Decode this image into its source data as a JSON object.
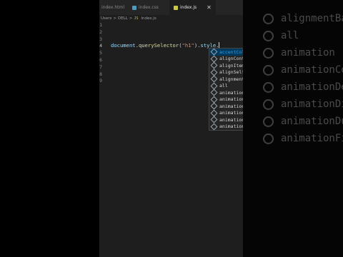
{
  "tabs": [
    {
      "label": "index.html",
      "icon": "html-file-icon",
      "color": "#e37933"
    },
    {
      "label": "index.css",
      "icon": "css-file-icon",
      "color": "#519aba"
    },
    {
      "label": "index.js",
      "icon": "js-file-icon",
      "color": "#cbcb41",
      "active": true
    }
  ],
  "close_label": "✕",
  "breadcrumb": {
    "parts": [
      "Users",
      "DELL"
    ],
    "separator": ">",
    "badge": "JS",
    "file": "index.js"
  },
  "gutter": {
    "lines": [
      "1",
      "2",
      "3",
      "4",
      "5",
      "6",
      "7",
      "8",
      "9"
    ],
    "current_line": "4"
  },
  "code": {
    "object": "document",
    "dot1": ".",
    "method": "querySelector",
    "open": "(",
    "arg": "\"h1\"",
    "close": ")",
    "dot2": ".",
    "prop": "style",
    "dot3": "."
  },
  "suggestions": [
    {
      "label": "accentColor",
      "selected": true
    },
    {
      "label": "alignContent"
    },
    {
      "label": "alignItems"
    },
    {
      "label": "alignSelf"
    },
    {
      "label": "alignmentBaseline"
    },
    {
      "label": "all"
    },
    {
      "label": "animation"
    },
    {
      "label": "animationComposition"
    },
    {
      "label": "animationDelay"
    },
    {
      "label": "animationDirection"
    },
    {
      "label": "animationDuration"
    },
    {
      "label": "animationFillMode"
    },
    {
      "label": "animationIterationCount"
    }
  ],
  "backdrop": [
    "alignmentBaseline",
    "all",
    "animation",
    "animationComposition",
    "animationDelay",
    "animationDirection",
    "animationDuration",
    "animationFillMode"
  ],
  "colors": {
    "editor_bg": "#1e1e1e",
    "selection": "#04395e",
    "accent": "#18a3ff"
  }
}
